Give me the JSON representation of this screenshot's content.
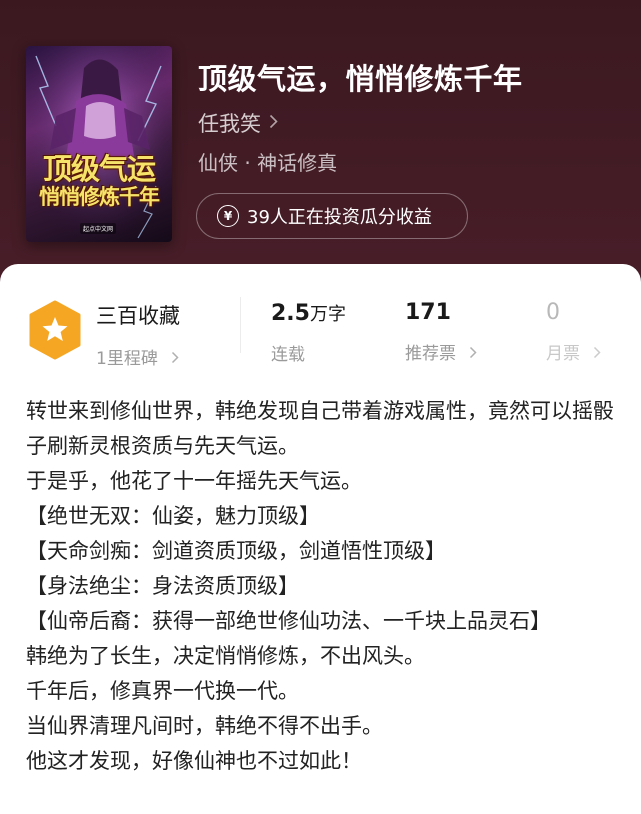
{
  "book": {
    "title": "顶级气运，悄悄修炼千年",
    "author": "任我笑",
    "genre": "仙侠 · 神话修真",
    "cover_title_line1": "顶级气运",
    "cover_title_line2": "悄悄修炼千年",
    "cover_publisher": "起点中文网"
  },
  "invest": {
    "icon": "yen-coin-icon",
    "label": "39人正在投资瓜分收益"
  },
  "stats": {
    "collect_label": "三百收藏",
    "milestone_label": "1里程碑",
    "word_count_value": "2.5",
    "word_count_unit": "万字",
    "status_label": "连载",
    "recommend_value": "171",
    "recommend_label": "推荐票",
    "monthly_value": "0",
    "monthly_label": "月票"
  },
  "description": [
    "转世来到修仙世界，韩绝发现自己带着游戏属性，竟然可以摇骰子刷新灵根资质与先天气运。",
    "于是乎，他花了十一年摇先天气运。",
    "【绝世无双：仙姿，魅力顶级】",
    "【天命剑痴：剑道资质顶级，剑道悟性顶级】",
    "【身法绝尘：身法资质顶级】",
    "【仙帝后裔：获得一部绝世修仙功法、一千块上品灵石】",
    "韩绝为了长生，决定悄悄修炼，不出风头。",
    "千年后，修真界一代换一代。",
    "当仙界清理凡间时，韩绝不得不出手。",
    "他这才发现，好像仙神也不过如此！"
  ],
  "colors": {
    "badge": "#f5a623",
    "header_bg": "#4a1f2a",
    "cover_title": "#f6e36a"
  }
}
